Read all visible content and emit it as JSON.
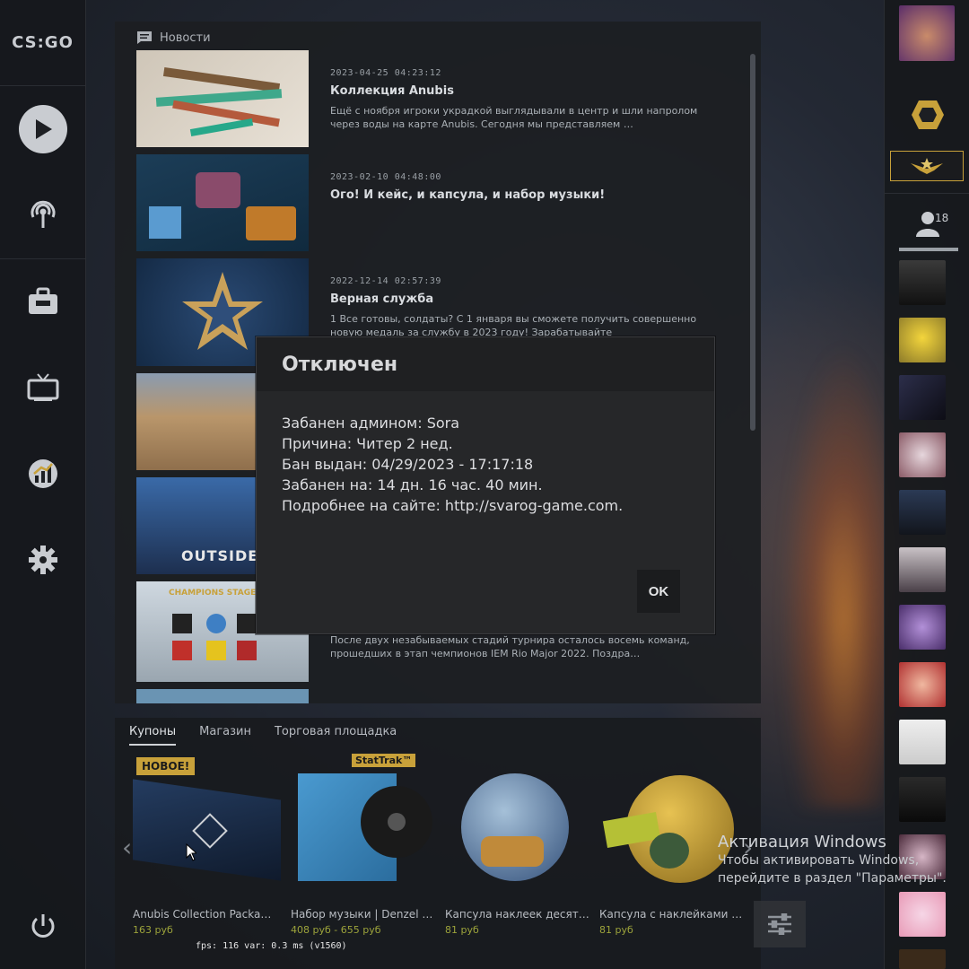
{
  "app": {
    "logo_text": "CS:GO"
  },
  "news": {
    "header": "Новости",
    "items": [
      {
        "date": "2023-04-25 04:23:12",
        "title": "Коллекция Anubis",
        "text": "Ещё с ноября игроки украдкой выглядывали в центр и шли напролом через воды на карте Anubis. Сегодня мы представляем …"
      },
      {
        "date": "2023-02-10 04:48:00",
        "title": "Ого! И кейс, и капсула, и набор музыки!",
        "text": ""
      },
      {
        "date": "2022-12-14 02:57:39",
        "title": "Верная служба",
        "text": "1 Все готовы, солдаты? С 1 января вы сможете получить совершенно новую медаль за службу в 2023 году! Зарабатывайте"
      },
      {
        "date": "",
        "title": "",
        "text": ""
      },
      {
        "date": "",
        "title": "",
        "text": "",
        "thumb_caption": "OUTSIDER"
      },
      {
        "date": "",
        "title": "",
        "text": "После двух незабываемых стадий турнира осталось восемь команд, прошедших в этап чемпионов IEM Rio Major 2022. Поздра…",
        "thumb_caption": "CHAMPIONS STAGE NOV"
      }
    ]
  },
  "store": {
    "tabs": [
      "Купоны",
      "Магазин",
      "Торговая площадка"
    ],
    "active_tab": 0,
    "badge": "НОВОЕ!",
    "stattrak": "StatTrak™",
    "items": [
      {
        "name": "Anubis Collection Packa…",
        "price": "163 руб"
      },
      {
        "name": "Набор музыки | Denzel …",
        "price": "408 руб - 655 руб"
      },
      {
        "name": "Капсула наклеек десят…",
        "price": "81 руб"
      },
      {
        "name": "Капсула с наклейками …",
        "price": "81 руб"
      }
    ]
  },
  "friends": {
    "count": "18"
  },
  "windows": {
    "title": "Активация Windows",
    "line1": "Чтобы активировать Windows,",
    "line2": "перейдите в раздел \"Параметры\"."
  },
  "fps": {
    "text": "fps:   116 var:  0.3 ms (v1560)"
  },
  "modal": {
    "title": "Отключен",
    "lines": [
      "Забанен админом: Sora",
      "Причина: Читер 2 нед.",
      "Бан выдан: 04/29/2023 - 17:17:18",
      "Забанен на: 14 дн. 16 час. 40 мин.",
      "Подробнее на сайте: http://svarog-game.com."
    ],
    "ok_label": "OK"
  },
  "colors": {
    "accent_gold": "#c8a13a",
    "price_green": "#9ca33b",
    "modal_bg": "#262729"
  }
}
